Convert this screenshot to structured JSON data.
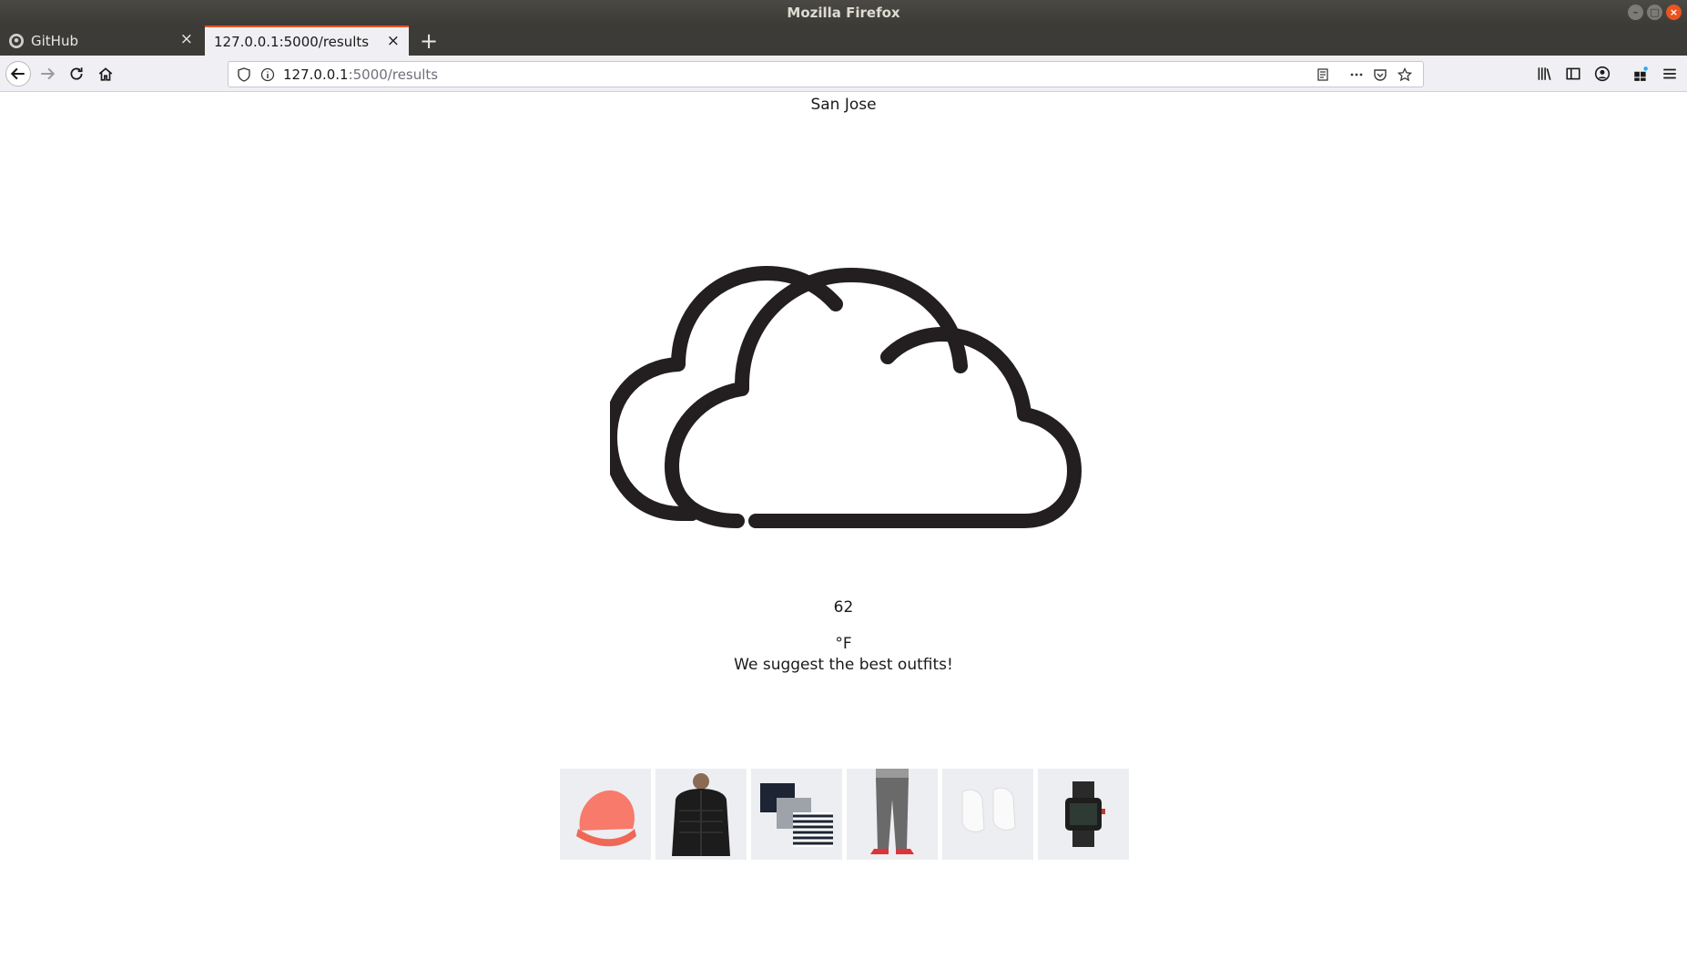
{
  "window": {
    "title": "Mozilla Firefox"
  },
  "tabs": [
    {
      "label": "GitHub",
      "active": false
    },
    {
      "label": "127.0.0.1:5000/results",
      "active": true
    }
  ],
  "urlbar": {
    "host": "127.0.0.1",
    "path": ":5000/results"
  },
  "page": {
    "city": "San Jose",
    "weather_icon": "cloudy-icon",
    "temperature": "62",
    "unit": "°F",
    "suggestion": "We suggest the best outfits!"
  },
  "outfits": [
    {
      "item": "beanie",
      "color": "#f87a6a"
    },
    {
      "item": "puffer-jacket",
      "color": "#1c1c1c"
    },
    {
      "item": "t-shirts",
      "color": "#1d2433"
    },
    {
      "item": "jogger-pants",
      "color": "#6a6a6a"
    },
    {
      "item": "sneakers",
      "color": "#f5f5f5"
    },
    {
      "item": "watch",
      "color": "#2a2a2a"
    }
  ],
  "colors": {
    "accent": "#e95420",
    "chrome": "#3c3b37",
    "toolbar": "#f0f0f4"
  }
}
